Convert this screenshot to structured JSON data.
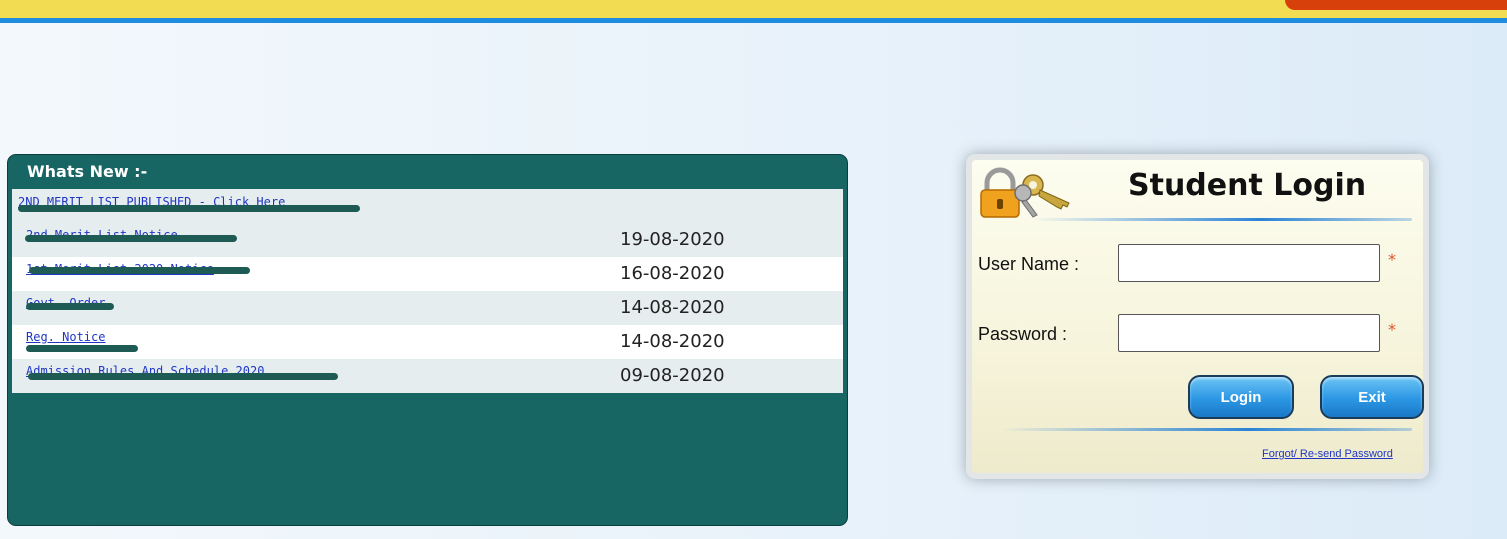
{
  "colors": {
    "header_yellow": "#f2dd52",
    "header_blue_line": "#1e8de0",
    "header_accent": "#d8400b",
    "news_panel": "#176664",
    "link": "#1f36c5",
    "required": "#e0542b",
    "button": "#2c97e4"
  },
  "whats_new": {
    "title": "Whats New :-",
    "items": [
      {
        "text": "2ND MERIT LIST PUBLISHED - Click Here",
        "date": ""
      },
      {
        "text": "2nd Merit List Notice",
        "date": "19-08-2020"
      },
      {
        "text": "1st Merit List 2020 Notice",
        "date": "16-08-2020"
      },
      {
        "text": "Govt. Order",
        "date": "14-08-2020"
      },
      {
        "text": "Reg. Notice",
        "date": "14-08-2020"
      },
      {
        "text": "Admission Rules And Schedule 2020",
        "date": "09-08-2020"
      }
    ]
  },
  "login": {
    "title": "Student Login",
    "icon": "lock-keys-icon",
    "username_label": "User Name :",
    "username_value": "",
    "password_label": "Password :",
    "password_value": "",
    "required_mark": "*",
    "login_button": "Login",
    "exit_button": "Exit",
    "forgot_link": "Forgot/ Re-send Password"
  }
}
